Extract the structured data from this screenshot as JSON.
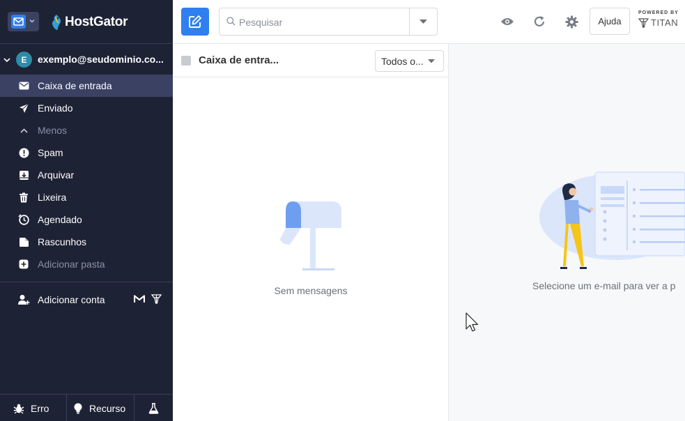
{
  "brand": {
    "name": "HostGator"
  },
  "sidebar": {
    "account": {
      "initial": "E",
      "email": "exemplo@seudominio.co..."
    },
    "folders": [
      {
        "id": "inbox",
        "label": "Caixa de entrada",
        "icon": "envelope-icon",
        "active": true
      },
      {
        "id": "sent",
        "label": "Enviado",
        "icon": "send-icon"
      },
      {
        "id": "less",
        "label": "Menos",
        "icon": "chevron-up-icon"
      },
      {
        "id": "spam",
        "label": "Spam",
        "icon": "alert-icon"
      },
      {
        "id": "archive",
        "label": "Arquivar",
        "icon": "archive-icon"
      },
      {
        "id": "trash",
        "label": "Lixeira",
        "icon": "trash-icon"
      },
      {
        "id": "scheduled",
        "label": "Agendado",
        "icon": "clock-icon"
      },
      {
        "id": "drafts",
        "label": "Rascunhos",
        "icon": "draft-icon"
      },
      {
        "id": "add_folder",
        "label": "Adicionar pasta",
        "icon": "plus-icon"
      }
    ],
    "add_account": "Adicionar conta",
    "footer": {
      "bug": "Erro",
      "feature": "Recurso"
    }
  },
  "topbar": {
    "search_placeholder": "Pesquisar",
    "help": "Ajuda",
    "powered_by": "POWERED BY",
    "titan": "TITAN"
  },
  "list": {
    "title": "Caixa de entra...",
    "filter": "Todos o...",
    "empty": "Sem mensagens"
  },
  "reading": {
    "placeholder": "Selecione um e-mail para ver a p"
  },
  "colors": {
    "sidebar_bg": "#1e2235",
    "sidebar_active": "#3b4163",
    "accent": "#2f7ff0"
  }
}
